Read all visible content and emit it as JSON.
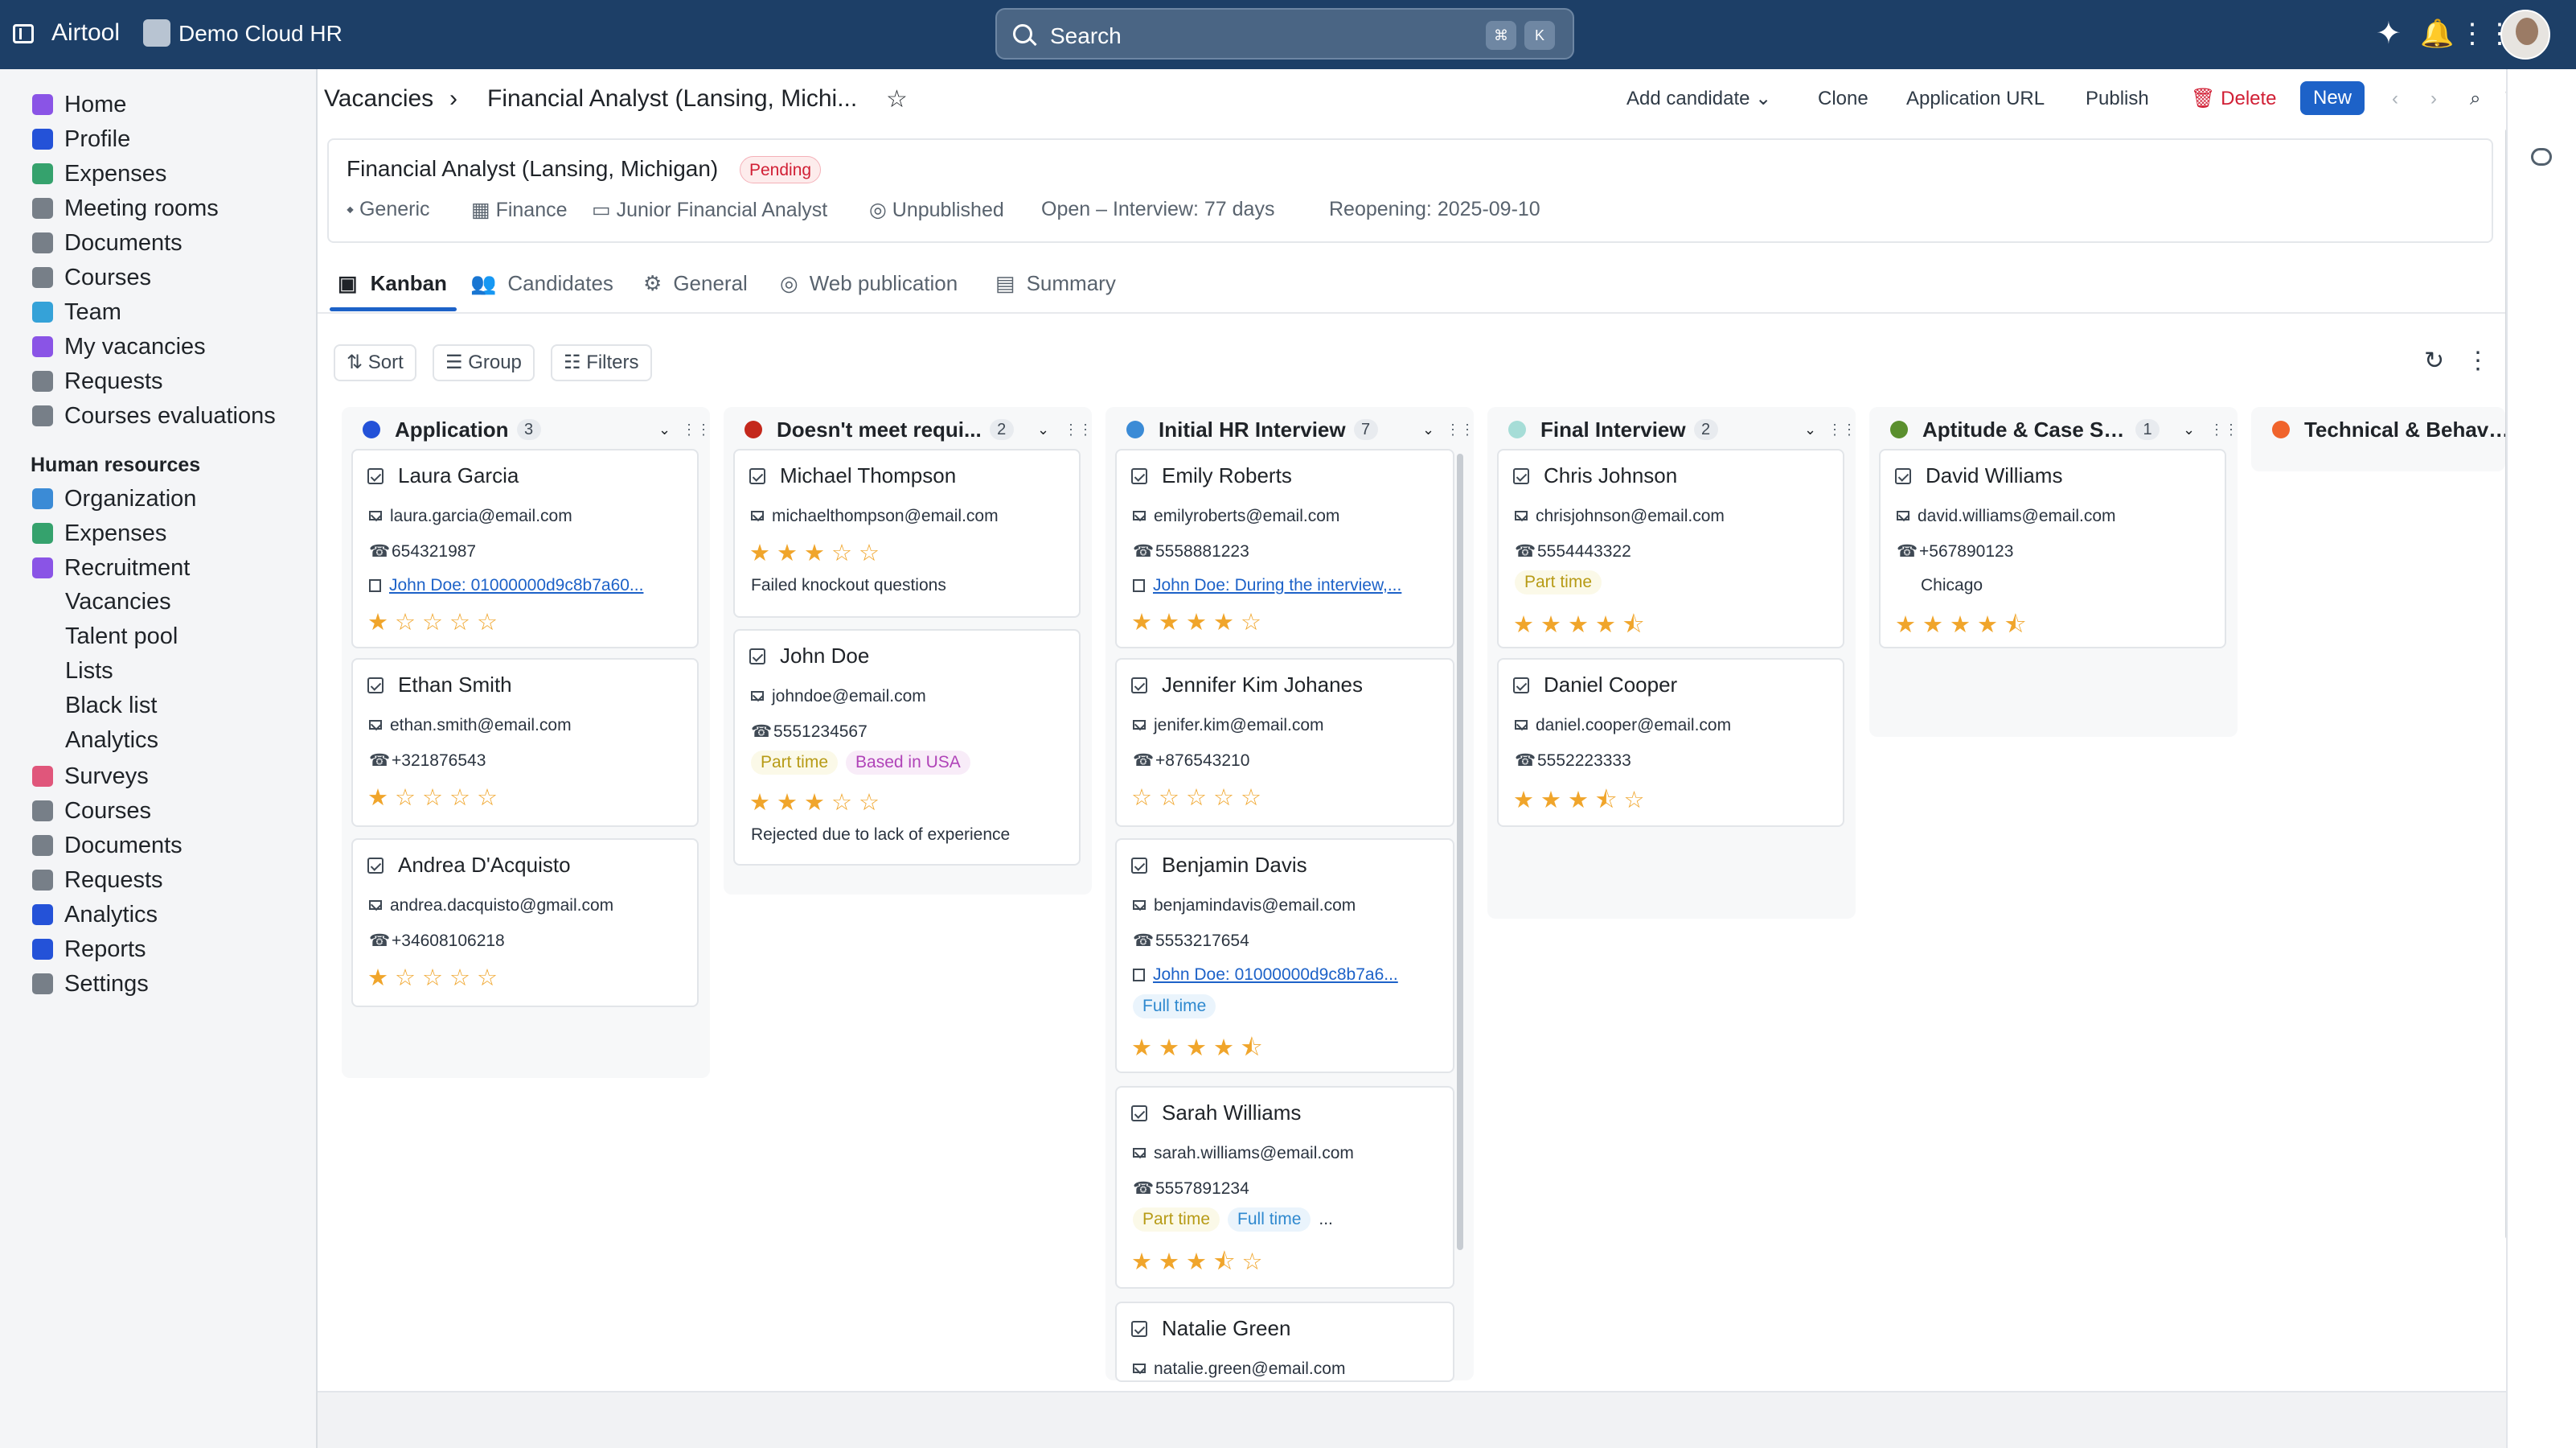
{
  "app": {
    "brand": "Airtool",
    "org": "Demo Cloud HR"
  },
  "search": {
    "placeholder": "Search",
    "k1": "⌘",
    "k2": "K"
  },
  "icons": [
    "sidebar-toggle-icon",
    "org-logo-icon",
    "search-icon",
    "sparkles-icon",
    "bell-icon",
    "grid-icon",
    "user-avatar"
  ],
  "sidebar": {
    "top": [
      "Home",
      "Profile",
      "Expenses",
      "Meeting rooms",
      "Documents",
      "Courses",
      "Team",
      "My vacancies",
      "Requests",
      "Courses evaluations"
    ],
    "section": "Human resources",
    "hr": [
      "Organization",
      "Expenses",
      "Recruitment"
    ],
    "recruitment": [
      "Vacancies",
      "Talent pool",
      "Lists",
      "Black list",
      "Analytics"
    ],
    "bottom": [
      "Surveys",
      "Courses",
      "Documents",
      "Requests",
      "Analytics",
      "Reports",
      "Settings"
    ]
  },
  "breadcrumb": {
    "root": "Vacancies",
    "sep": "›",
    "current": "Financial Analyst (Lansing, Michi...",
    "star": "☆"
  },
  "toolbar": {
    "add": "Add candidate ⌄",
    "clone": "Clone",
    "url": "Application URL",
    "publish": "Publish",
    "delete": "Delete",
    "new": "New"
  },
  "vacancy": {
    "title": "Financial Analyst (Lansing, Michigan)",
    "status": "Pending",
    "meta": [
      "Generic",
      "Finance",
      "Junior Financial Analyst",
      "Unpublished",
      "Open – Interview: 77 days",
      "Reopening: 2025-09-10"
    ]
  },
  "tabs": [
    "Kanban",
    "Candidates",
    "General",
    "Web publication",
    "Summary"
  ],
  "kanban_tools": {
    "sort": "Sort",
    "group": "Group",
    "filters": "Filters"
  },
  "columns": [
    {
      "title": "Application",
      "count": "3",
      "color": "#2452d8",
      "cards": [
        {
          "name": "Laura Garcia",
          "email": "laura.garcia@email.com",
          "phone": "654321987",
          "link": "John Doe: 01000000d9c8b7a60...",
          "stars": "★☆☆☆☆"
        },
        {
          "name": "Ethan Smith",
          "email": "ethan.smith@email.com",
          "phone": "+321876543",
          "stars": "★☆☆☆☆"
        },
        {
          "name": "Andrea D'Acquisto",
          "email": "andrea.dacquisto@gmail.com",
          "phone": "+34608106218",
          "stars": "★☆☆☆☆"
        }
      ]
    },
    {
      "title": "Doesn't meet requi...",
      "count": "2",
      "color": "#c4281c",
      "cards": [
        {
          "name": "Michael Thompson",
          "email": "michaelthompson@email.com",
          "stars": "★★★☆☆",
          "note": "Failed knockout questions"
        },
        {
          "name": "John Doe",
          "email": "johndoe@email.com",
          "phone": "5551234567",
          "tags": [
            "Part time",
            "Based in USA"
          ],
          "stars": "★★★☆☆",
          "note": "Rejected due to lack of experience"
        }
      ]
    },
    {
      "title": "Initial HR Interview",
      "count": "7",
      "color": "#3b8bd6",
      "cards": [
        {
          "name": "Emily Roberts",
          "email": "emilyroberts@email.com",
          "phone": "5558881223",
          "link": "John Doe: During the interview,...",
          "stars": "★★★★☆"
        },
        {
          "name": "Jennifer Kim Johanes",
          "email": "jenifer.kim@email.com",
          "phone": "+876543210",
          "stars": "☆☆☆☆☆"
        },
        {
          "name": "Benjamin Davis",
          "email": "benjamindavis@email.com",
          "phone": "5553217654",
          "link": "John Doe: 01000000d9c8b7a6...",
          "tags": [
            "Full time"
          ],
          "stars": "★★★★⯪"
        },
        {
          "name": "Sarah Williams",
          "email": "sarah.williams@email.com",
          "phone": "5557891234",
          "tags": [
            "Part time",
            "Full time",
            "..."
          ],
          "stars": "★★★⯪☆"
        },
        {
          "name": "Natalie Green",
          "email": "natalie.green@email.com"
        }
      ]
    },
    {
      "title": "Final Interview",
      "count": "2",
      "color": "#a6ddd7",
      "cards": [
        {
          "name": "Chris Johnson",
          "email": "chrisjohnson@email.com",
          "phone": "5554443322",
          "tags": [
            "Part time"
          ],
          "stars": "★★★★⯪"
        },
        {
          "name": "Daniel Cooper",
          "email": "daniel.cooper@email.com",
          "phone": "5552223333",
          "stars": "★★★⯪☆"
        }
      ]
    },
    {
      "title": "Aptitude & Case St...",
      "count": "1",
      "color": "#5a8f2e",
      "cards": [
        {
          "name": "David Williams",
          "email": "david.williams@email.com",
          "phone": "+567890123",
          "note": "Chicago",
          "stars": "★★★★⯪"
        }
      ]
    },
    {
      "title": "Technical & Behavi...",
      "count": "",
      "color": "#f0642c",
      "cards": []
    }
  ]
}
